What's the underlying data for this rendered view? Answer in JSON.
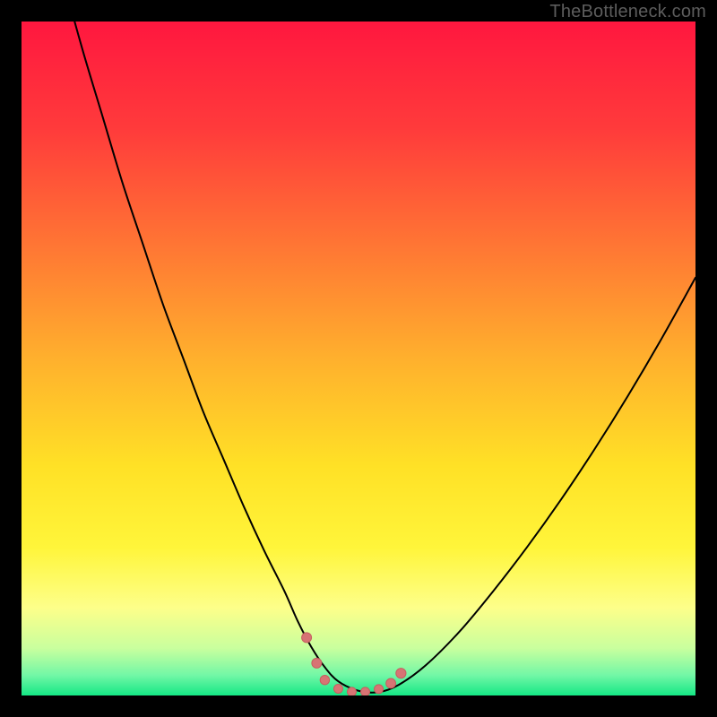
{
  "watermark": "TheBottleneck.com",
  "colors": {
    "frame_bg": "#000000",
    "gradient_stops": [
      {
        "offset": 0.0,
        "color": "#ff173f"
      },
      {
        "offset": 0.16,
        "color": "#ff3b3b"
      },
      {
        "offset": 0.33,
        "color": "#ff7534"
      },
      {
        "offset": 0.5,
        "color": "#ffb02d"
      },
      {
        "offset": 0.66,
        "color": "#ffe126"
      },
      {
        "offset": 0.78,
        "color": "#fff53a"
      },
      {
        "offset": 0.87,
        "color": "#fdff8a"
      },
      {
        "offset": 0.93,
        "color": "#c9ff9e"
      },
      {
        "offset": 0.97,
        "color": "#72f7a6"
      },
      {
        "offset": 1.0,
        "color": "#15e785"
      }
    ],
    "curve": "#000000",
    "marker_fill": "#d77474",
    "marker_stroke": "#c55f5f"
  },
  "chart_data": {
    "type": "line",
    "title": "",
    "xlabel": "",
    "ylabel": "",
    "xlim": [
      0,
      100
    ],
    "ylim": [
      0,
      100
    ],
    "grid": false,
    "legend": false,
    "series": [
      {
        "name": "bottleneck-curve",
        "x": [
          0,
          3,
          6,
          9,
          12,
          15,
          18,
          21,
          24,
          27,
          30,
          33,
          36,
          39,
          41,
          43,
          45,
          47,
          50,
          53,
          56,
          60,
          65,
          70,
          75,
          80,
          85,
          90,
          95,
          100
        ],
        "y": [
          132,
          119,
          107,
          96,
          86,
          76,
          67,
          58,
          50,
          42,
          35,
          28,
          21.5,
          15.5,
          11,
          7.2,
          4.2,
          2.1,
          0.7,
          0.5,
          1.6,
          4.5,
          9.5,
          15.5,
          22,
          29,
          36.5,
          44.5,
          53,
          62
        ]
      }
    ],
    "markers": {
      "name": "trough-markers",
      "x": [
        42.3,
        43.8,
        45.0,
        47.0,
        49.0,
        51.0,
        53.0,
        54.8,
        56.3
      ],
      "y": [
        8.6,
        4.8,
        2.3,
        1.0,
        0.55,
        0.55,
        0.95,
        1.8,
        3.3
      ],
      "r": [
        5.5,
        5.5,
        5.2,
        5.0,
        5.0,
        5.0,
        5.0,
        5.4,
        5.6
      ]
    }
  }
}
